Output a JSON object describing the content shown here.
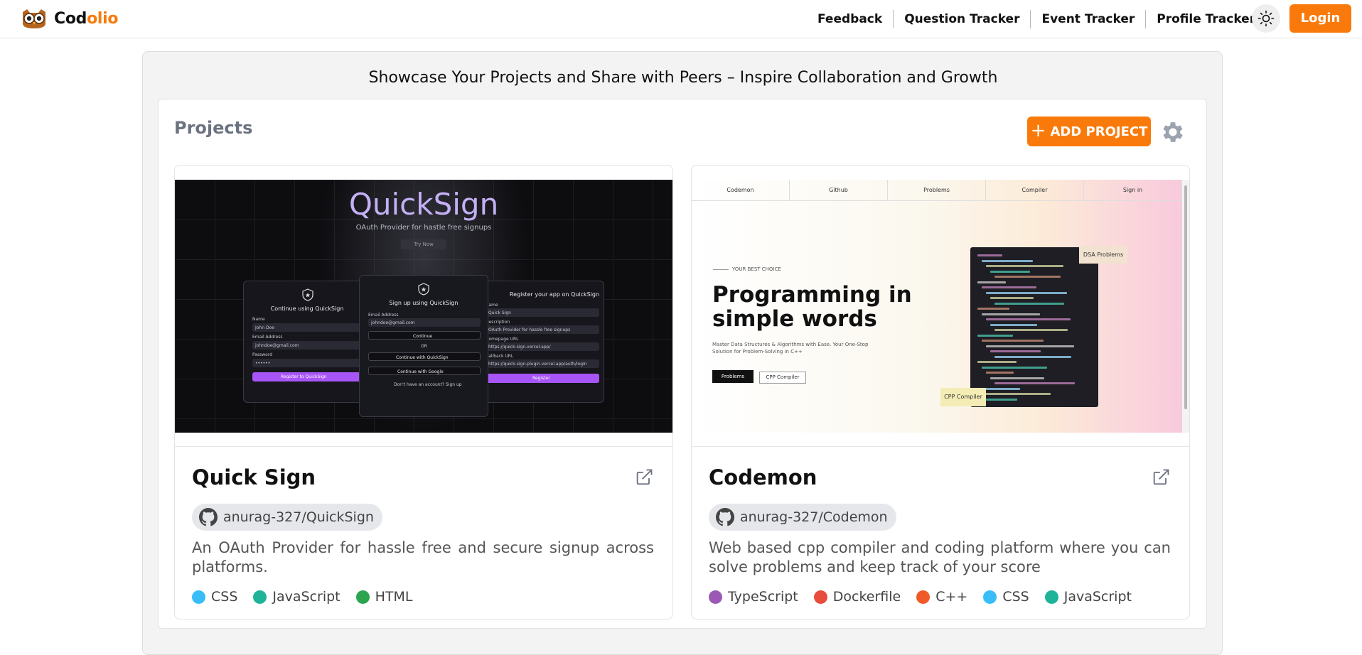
{
  "nav": {
    "logo_part1": "Cod",
    "logo_part2": "olio",
    "links": [
      "Feedback",
      "Question Tracker",
      "Event Tracker",
      "Profile Tracker"
    ],
    "theme_icon": "sun-icon",
    "login_label": "Login"
  },
  "page": {
    "headline": "Showcase Your Projects and Share with Peers – Inspire Collaboration and Growth",
    "section_title": "Projects",
    "add_project_label": "ADD PROJECT",
    "settings_icon": "gear-icon"
  },
  "projects": [
    {
      "title": "Quick Sign",
      "repo": "anurag-327/QuickSign",
      "description": "An OAuth Provider for hassle free and secure signup across platforms.",
      "languages": [
        {
          "name": "CSS",
          "color": "#38bdf8"
        },
        {
          "name": "JavaScript",
          "color": "#1fb39a"
        },
        {
          "name": "HTML",
          "color": "#2da44e"
        }
      ],
      "thumbnail": {
        "logo": "QuickSign",
        "subtitle": "OAuth Provider for hastle free signups",
        "try_now": "Try Now",
        "left_title": "Continue using QuickSign",
        "center_title": "Sign up using QuickSign",
        "right_title": "Register your app on QuickSign",
        "left_labels": [
          "Name",
          "Email Address",
          "Password"
        ],
        "left_values": [
          "John Doe",
          "johndoe@gmail.com",
          "••••••"
        ],
        "left_button": "Register to QuickSign",
        "center_label": "Email Address",
        "center_value": "johndoe@gmail.com",
        "center_continue": "Continue",
        "center_or": "OR",
        "center_qs": "Continue with QuickSign",
        "center_google": "Continue with Google",
        "center_footer": "Don't have an account? Sign up",
        "right_labels": [
          "Name",
          "Description",
          "Homepage URL",
          "Callback URL"
        ],
        "right_values": [
          "Quick Sign",
          "OAuth Provider for hassle free signups",
          "https://quick-sign.vercel.app/",
          "https://quick-sign-plugin.vercel.app/auth/login"
        ],
        "right_button": "Register"
      }
    },
    {
      "title": "Codemon",
      "repo": "anurag-327/Codemon",
      "description": "Web based cpp compiler and coding platform where you can solve problems and keep track of your score",
      "languages": [
        {
          "name": "TypeScript",
          "color": "#9b59b6"
        },
        {
          "name": "Dockerfile",
          "color": "#e74c3c"
        },
        {
          "name": "C++",
          "color": "#f05a28"
        },
        {
          "name": "CSS",
          "color": "#38bdf8"
        },
        {
          "name": "JavaScript",
          "color": "#1fb39a"
        }
      ],
      "thumbnail": {
        "nav": [
          "Codemon",
          "Github",
          "Problems",
          "Compiler",
          "Sign in"
        ],
        "kicker": "YOUR BEST CHOICE",
        "heading_line1": "Programming in",
        "heading_line2": "simple words",
        "paragraph": "Master Data Structures & Algorithms with Ease. Your One-Stop Solution for Problem-Solving in C++",
        "button_primary": "Problems",
        "button_secondary": "CPP Compiler",
        "tag_top": "DSA Problems",
        "tag_bottom": "CPP Compiler"
      }
    }
  ]
}
